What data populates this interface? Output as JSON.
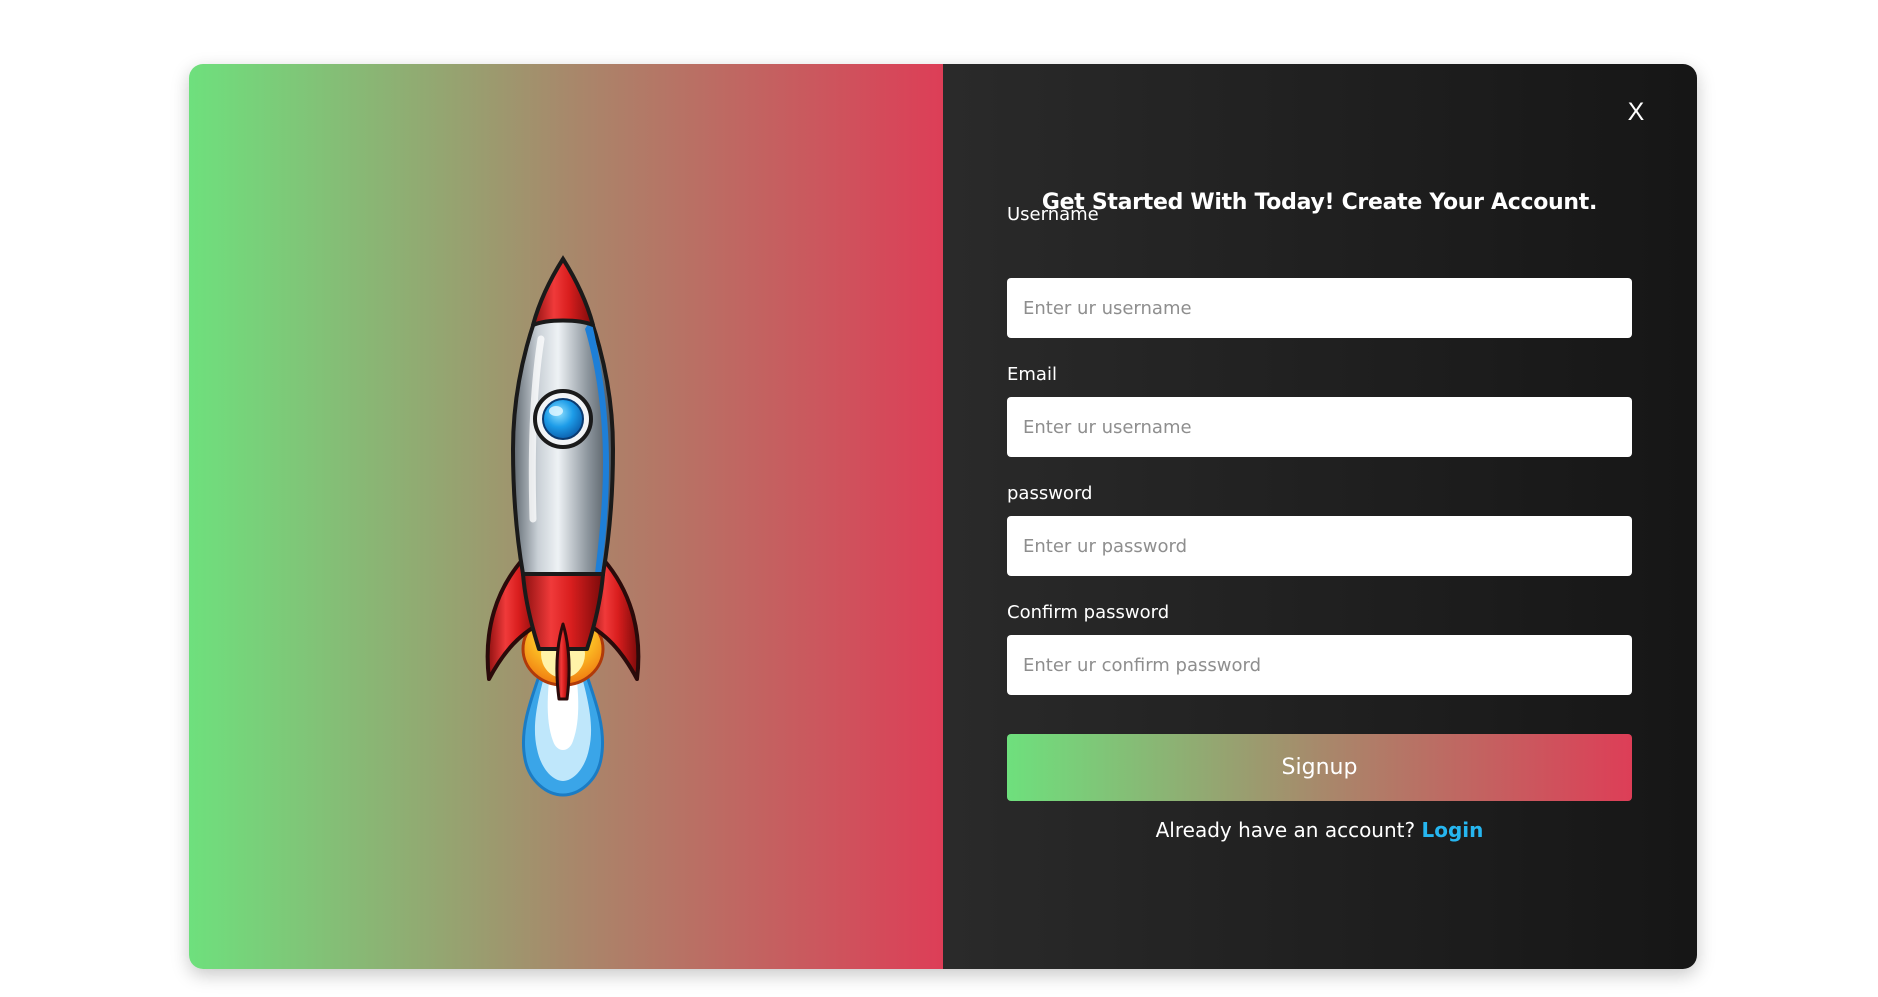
{
  "modal": {
    "close_label": "X",
    "title": "Get Started With Today! Create Your Account.",
    "fields": [
      {
        "label": "Username",
        "placeholder": "Enter ur username"
      },
      {
        "label": "Email",
        "placeholder": "Enter ur username"
      },
      {
        "label": "password",
        "placeholder": "Enter ur password"
      },
      {
        "label": "Confirm password",
        "placeholder": "Enter ur confirm password"
      }
    ],
    "signup_label": "Signup",
    "login_prompt": "Already have an account?",
    "login_link": "Login"
  },
  "illustration": {
    "icon": "rocket-icon"
  },
  "colors": {
    "gradient_start": "#6ee07d",
    "gradient_mid": "#a7896b",
    "gradient_end": "#dd3e57",
    "panel_dark": "#1e1e1e",
    "link": "#26b6f0"
  }
}
